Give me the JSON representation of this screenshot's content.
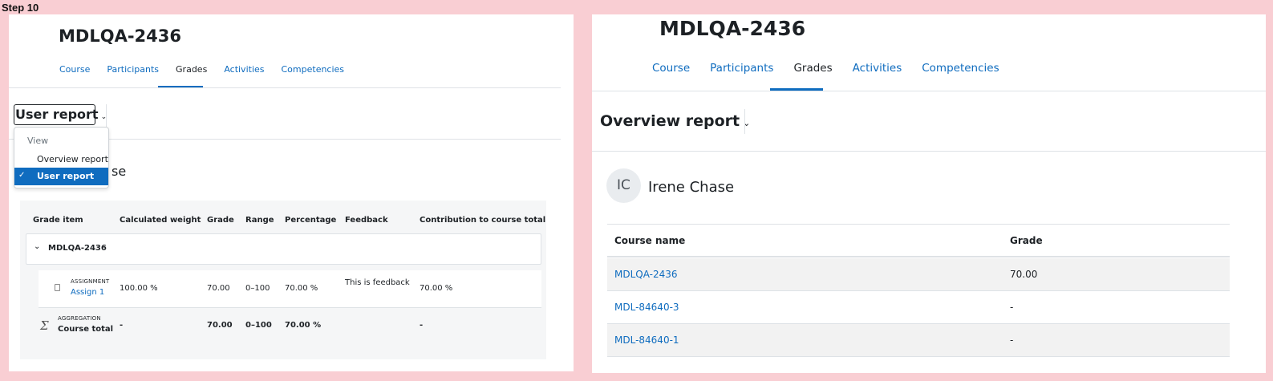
{
  "step_label": "Step 10",
  "left": {
    "course_title": "MDLQA-2436",
    "tabs": [
      "Course",
      "Participants",
      "Grades",
      "Activities",
      "Competencies"
    ],
    "report_selector": {
      "label": "User report",
      "chevron": "⌄"
    },
    "dropdown": {
      "header": "View",
      "items": [
        {
          "label": "Overview report",
          "selected": false
        },
        {
          "label": "User report",
          "selected": true,
          "check": "✓"
        }
      ]
    },
    "obscured_text": "se",
    "grade_table": {
      "headers": [
        "Grade item",
        "Calculated weight",
        "Grade",
        "Range",
        "Percentage",
        "Feedback",
        "Contribution to course total"
      ],
      "course_row": {
        "chevron": "⌄",
        "name": "MDLQA-2436"
      },
      "item": {
        "type": "ASSIGNMENT",
        "name": "Assign 1",
        "weight": "100.00 %",
        "grade": "70.00",
        "range": "0–100",
        "percentage": "70.00 %",
        "feedback": "This is feedback",
        "contribution": "70.00 %"
      },
      "total": {
        "type": "AGGREGATION",
        "symbol": "Σ",
        "name": "Course total",
        "weight": "-",
        "grade": "70.00",
        "range": "0–100",
        "percentage": "70.00 %",
        "contribution": "-"
      }
    }
  },
  "right": {
    "course_title": "MDLQA-2436",
    "tabs": [
      "Course",
      "Participants",
      "Grades",
      "Activities",
      "Competencies"
    ],
    "report_title": "Overview report",
    "report_chevron": "⌄",
    "user": {
      "initials": "IC",
      "name": "Irene Chase"
    },
    "table": {
      "headers": [
        "Course name",
        "Grade"
      ],
      "rows": [
        {
          "course": "MDLQA-2436",
          "grade": "70.00"
        },
        {
          "course": "MDL-84640-3",
          "grade": "-"
        },
        {
          "course": "MDL-84640-1",
          "grade": "-"
        }
      ]
    }
  }
}
